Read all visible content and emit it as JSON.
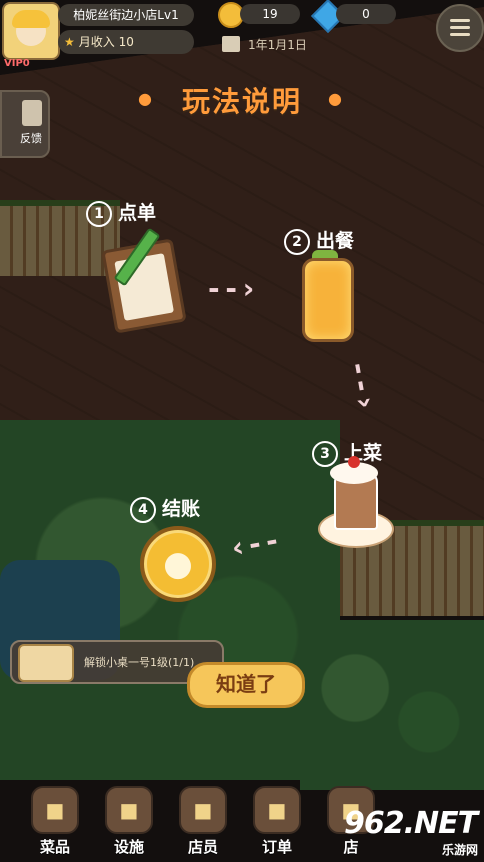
{
  "header": {
    "shop_name": "柏妮丝街边小店Lv1",
    "income_label": "月收入 10",
    "coins": "19",
    "gems": "0",
    "date": "1年1月1日",
    "vip": "VIP0"
  },
  "side": {
    "feedback_label": "反馈"
  },
  "dialog": {
    "title": "玩法说明",
    "steps": [
      {
        "num": "1",
        "label": "点单"
      },
      {
        "num": "2",
        "label": "出餐"
      },
      {
        "num": "3",
        "label": "上菜"
      },
      {
        "num": "4",
        "label": "结账"
      }
    ],
    "ok_label": "知道了"
  },
  "task": {
    "text": "解锁小桌一号1级(1/1)"
  },
  "tabs": [
    {
      "label": "菜品"
    },
    {
      "label": "设施"
    },
    {
      "label": "店员"
    },
    {
      "label": "订单"
    },
    {
      "label": "店"
    }
  ],
  "watermark": {
    "main": "962.NET",
    "sub": "乐游网"
  },
  "colors": {
    "accent": "#ff9b3b",
    "button": "#f6c65a"
  }
}
